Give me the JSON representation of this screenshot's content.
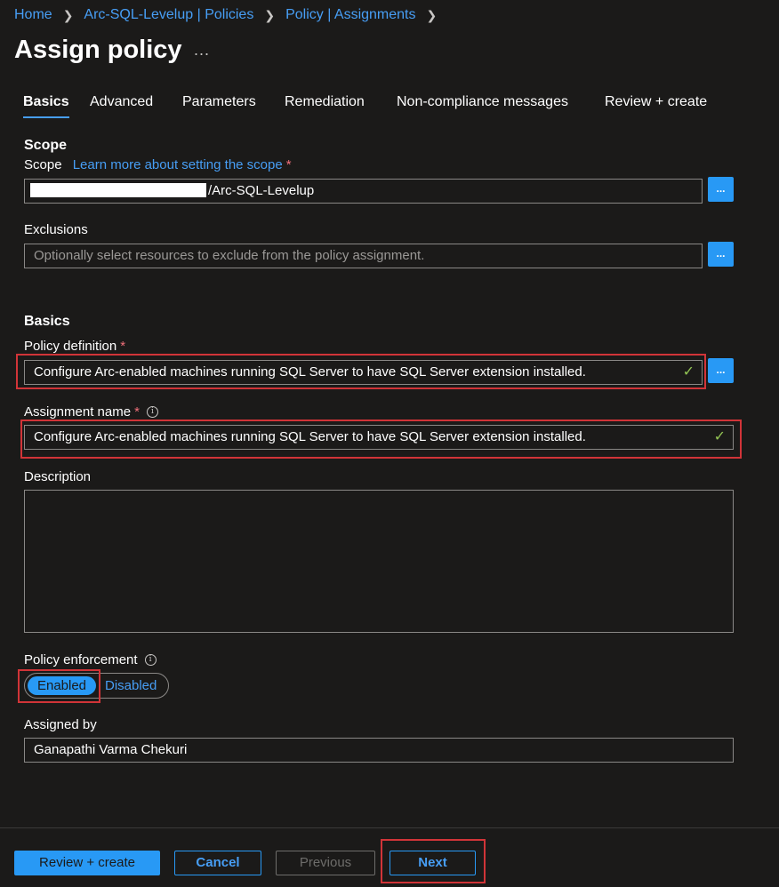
{
  "breadcrumb": [
    "Home",
    "Arc-SQL-Levelup | Policies",
    "Policy | Assignments"
  ],
  "title": "Assign policy",
  "more_label": "...",
  "tabs": [
    "Basics",
    "Advanced",
    "Parameters",
    "Remediation",
    "Non-compliance messages",
    "Review + create"
  ],
  "scope": {
    "section_title": "Scope",
    "label": "Scope",
    "learn_more": "Learn more about setting the scope",
    "required_mark": "*",
    "value": "/Arc-SQL-Levelup",
    "browse_label": "..."
  },
  "exclusions": {
    "label": "Exclusions",
    "placeholder": "Optionally select resources to exclude from the policy assignment.",
    "browse_label": "..."
  },
  "basics": {
    "section_title": "Basics",
    "policy_definition": {
      "label": "Policy definition",
      "required_mark": "*",
      "value": "Configure Arc-enabled machines running SQL Server to have SQL Server extension installed.",
      "browse_label": "..."
    },
    "assignment_name": {
      "label": "Assignment name",
      "required_mark": "*",
      "value": "Configure Arc-enabled machines running SQL Server to have SQL Server extension installed."
    },
    "description": {
      "label": "Description",
      "value": ""
    },
    "policy_enforcement": {
      "label": "Policy enforcement",
      "options": [
        "Enabled",
        "Disabled"
      ],
      "selected": "Enabled"
    },
    "assigned_by": {
      "label": "Assigned by",
      "value": "Ganapathi Varma Chekuri"
    }
  },
  "icons": {
    "check": "checkmark-icon",
    "info": "info-icon",
    "chevron": "chevron-right-icon"
  },
  "footer": {
    "review_create": "Review + create",
    "cancel": "Cancel",
    "previous": "Previous",
    "next": "Next"
  },
  "colors": {
    "background": "#1b1a19",
    "accent": "#2899f5",
    "link": "#479ef5",
    "highlight": "#d13438",
    "valid": "#92c353",
    "required": "#f1707b"
  }
}
